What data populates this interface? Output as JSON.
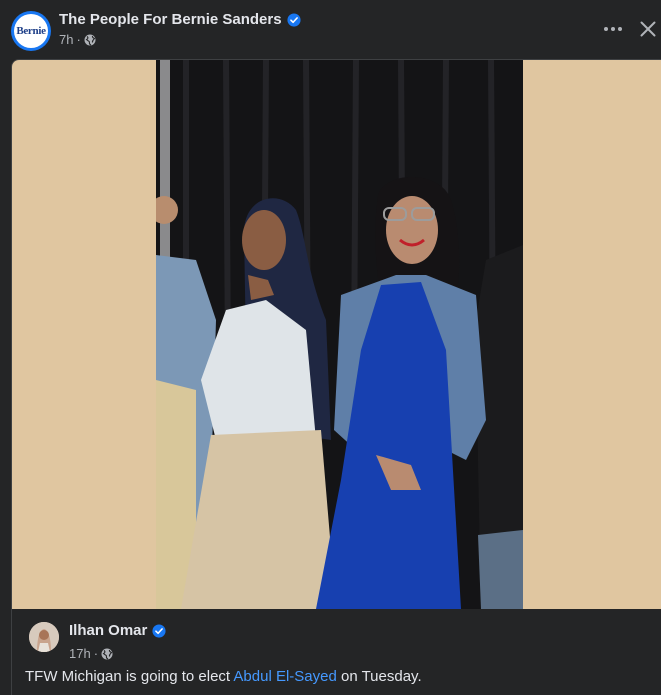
{
  "post": {
    "author": "The People For Bernie Sanders",
    "avatar_logo_text": "Bernie",
    "time": "7h",
    "separator": "·",
    "audience_icon": "globe-icon",
    "verified_icon": "verified-badge-icon",
    "more_icon": "more-options-icon",
    "close_icon": "close-icon"
  },
  "shared": {
    "author": "Ilhan Omar",
    "time": "17h",
    "separator": "·",
    "text_before": "TFW Michigan is going to elect ",
    "mention": "Abdul El-Sayed",
    "text_after": " on Tuesday."
  },
  "colors": {
    "background": "#242526",
    "photo_letterbox": "#e0c6a0",
    "verified_blue": "#1877f2",
    "link_blue": "#4599ff",
    "secondary_text": "#b0b3b8"
  }
}
